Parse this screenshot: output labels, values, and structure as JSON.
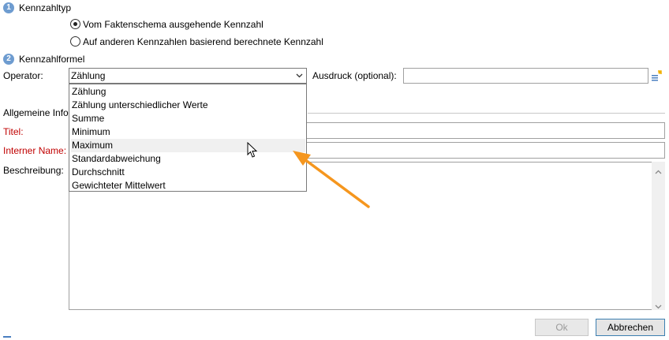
{
  "sections": {
    "type": {
      "number": "1",
      "title": "Kennzahltyp"
    },
    "formula": {
      "number": "2",
      "title": "Kennzahlformel"
    }
  },
  "radio_options": [
    {
      "label": "Vom Faktenschema ausgehende Kennzahl",
      "selected": true
    },
    {
      "label": "Auf anderen Kennzahlen basierend berechnete Kennzahl",
      "selected": false
    }
  ],
  "operator": {
    "label": "Operator:",
    "value": "Zählung",
    "options": [
      "Zählung",
      "Zählung unterschiedlicher Werte",
      "Summe",
      "Minimum",
      "Maximum",
      "Standardabweichung",
      "Durchschnitt",
      "Gewichteter Mittelwert"
    ],
    "highlighted": "Maximum"
  },
  "expression": {
    "label": "Ausdruck (optional):",
    "value": ""
  },
  "general_info": {
    "title": "Allgemeine Info"
  },
  "fields": {
    "title_label": "Titel:",
    "internal_name_label": "Interner Name:",
    "description_label": "Beschreibung:"
  },
  "buttons": {
    "ok": "Ok",
    "cancel": "Abbrechen"
  },
  "colors": {
    "required_label": "#c00000",
    "annotation_arrow": "#f5961e",
    "step_badge": "#6e9cd0"
  },
  "icons": {
    "expression_editor": "list-edit-icon"
  }
}
